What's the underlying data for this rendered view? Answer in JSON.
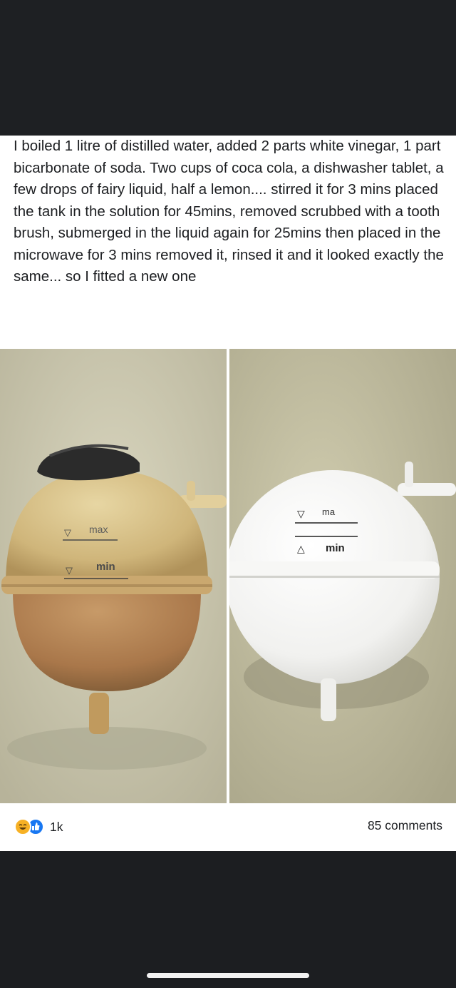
{
  "post": {
    "text": "I boiled 1 litre of distilled water, added 2 parts white vinegar, 1 part bicarbonate of soda. Two cups of coca cola, a dishwasher tablet, a few drops of fairy liquid, half a lemon.... stirred it for 3 mins placed the tank in the solution for 45mins, removed scrubbed with a tooth brush, submerged in the liquid again for 25mins then placed in the microwave for 3 mins removed it, rinsed it and it looked exactly the same... so I fitted a new one"
  },
  "photos": {
    "left": {
      "max_label": "max",
      "min_label": "min"
    },
    "right": {
      "max_label": "ma",
      "min_label": "min"
    }
  },
  "footer": {
    "reaction_count": "1k",
    "comments": "85 comments"
  },
  "colors": {
    "screen_dark": "#1c1e21",
    "card": "#ffffff",
    "like_blue": "#1877f2",
    "haha_yellow": "#f7b125"
  },
  "icons": [
    "haha-reaction-icon",
    "like-reaction-icon"
  ]
}
